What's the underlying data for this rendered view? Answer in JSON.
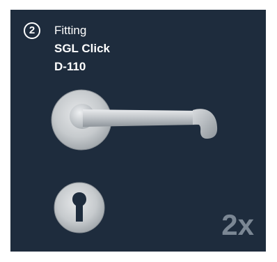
{
  "card": {
    "step_number": "2",
    "category": "Fitting",
    "product_name": "SGL Click",
    "product_code": "D-110",
    "quantity": "2x"
  },
  "colors": {
    "background": "#1e2c3d",
    "text": "#ffffff",
    "quantity_text": "#7b8794",
    "steel": "#c7cbcf"
  },
  "icons": {
    "handle": "door-handle-icon",
    "escutcheon": "key-escutcheon-icon"
  }
}
